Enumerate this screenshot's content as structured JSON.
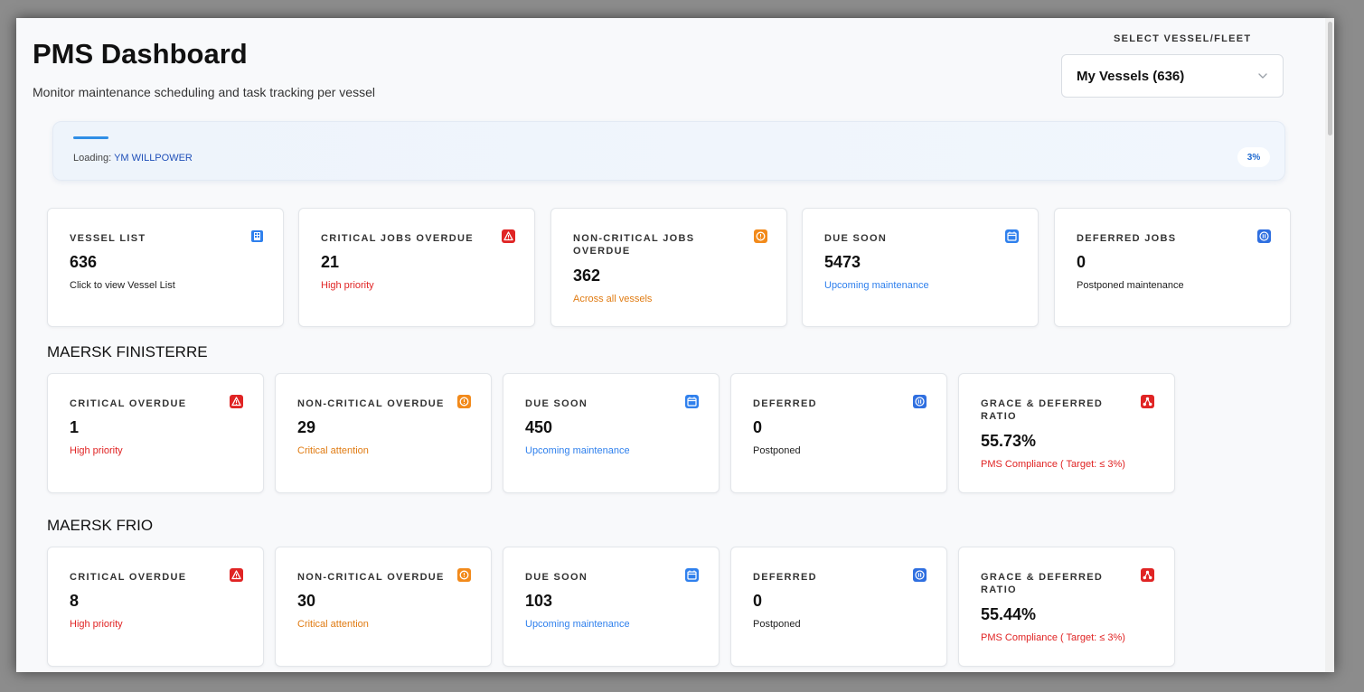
{
  "header": {
    "title": "PMS Dashboard",
    "subtitle": "Monitor maintenance scheduling and task tracking per vessel"
  },
  "vessel_select": {
    "label": "SELECT VESSEL/FLEET",
    "value": "My Vessels (636)",
    "icon": "chevron-down-icon"
  },
  "loading": {
    "prefix": "Loading:",
    "vessel": "YM WILLPOWER",
    "percent_label": "3%",
    "progress": 0.03
  },
  "summary_cards": [
    {
      "label": "VESSEL LIST",
      "value": "636",
      "sub": "Click to view Vessel List",
      "sub_color": "#222222",
      "icon": "building-icon",
      "icon_color": "#2f80ed"
    },
    {
      "label": "CRITICAL JOBS OVERDUE",
      "value": "21",
      "sub": "High priority",
      "sub_color": "#e02424",
      "icon": "warning-triangle-icon",
      "icon_color": "#e02424"
    },
    {
      "label": "NON-CRITICAL JOBS OVERDUE",
      "value": "362",
      "sub": "Across all vessels",
      "sub_color": "#e07b12",
      "icon": "alert-circle-icon",
      "icon_color": "#f28a1b"
    },
    {
      "label": "DUE SOON",
      "value": "5473",
      "sub": "Upcoming maintenance",
      "sub_color": "#2f80ed",
      "icon": "calendar-icon",
      "icon_color": "#2f80ed"
    },
    {
      "label": "DEFERRED JOBS",
      "value": "0",
      "sub": "Postponed maintenance",
      "sub_color": "#222222",
      "icon": "pause-circle-icon",
      "icon_color": "#2f6fe0"
    }
  ],
  "vessels": [
    {
      "name": "MAERSK FINISTERRE",
      "cards": [
        {
          "label": "CRITICAL OVERDUE",
          "value": "1",
          "sub": "High priority",
          "icon": "warning-triangle-icon"
        },
        {
          "label": "NON-CRITICAL OVERDUE",
          "value": "29",
          "sub": "Critical attention",
          "icon": "alert-circle-icon"
        },
        {
          "label": "DUE SOON",
          "value": "450",
          "sub": "Upcoming maintenance",
          "icon": "calendar-icon"
        },
        {
          "label": "DEFERRED",
          "value": "0",
          "sub": "Postponed",
          "icon": "pause-circle-icon"
        },
        {
          "label": "GRACE & DEFERRED RATIO",
          "value": "55.73%",
          "sub": "PMS Compliance ( Target: ≤ 3%)",
          "icon": "network-icon"
        }
      ]
    },
    {
      "name": "MAERSK FRIO",
      "cards": [
        {
          "label": "CRITICAL OVERDUE",
          "value": "8",
          "sub": "High priority",
          "icon": "warning-triangle-icon"
        },
        {
          "label": "NON-CRITICAL OVERDUE",
          "value": "30",
          "sub": "Critical attention",
          "icon": "alert-circle-icon"
        },
        {
          "label": "DUE SOON",
          "value": "103",
          "sub": "Upcoming maintenance",
          "icon": "calendar-icon"
        },
        {
          "label": "DEFERRED",
          "value": "0",
          "sub": "Postponed",
          "icon": "pause-circle-icon"
        },
        {
          "label": "GRACE & DEFERRED RATIO",
          "value": "55.44%",
          "sub": "PMS Compliance ( Target: ≤ 3%)",
          "icon": "network-icon"
        }
      ]
    }
  ]
}
